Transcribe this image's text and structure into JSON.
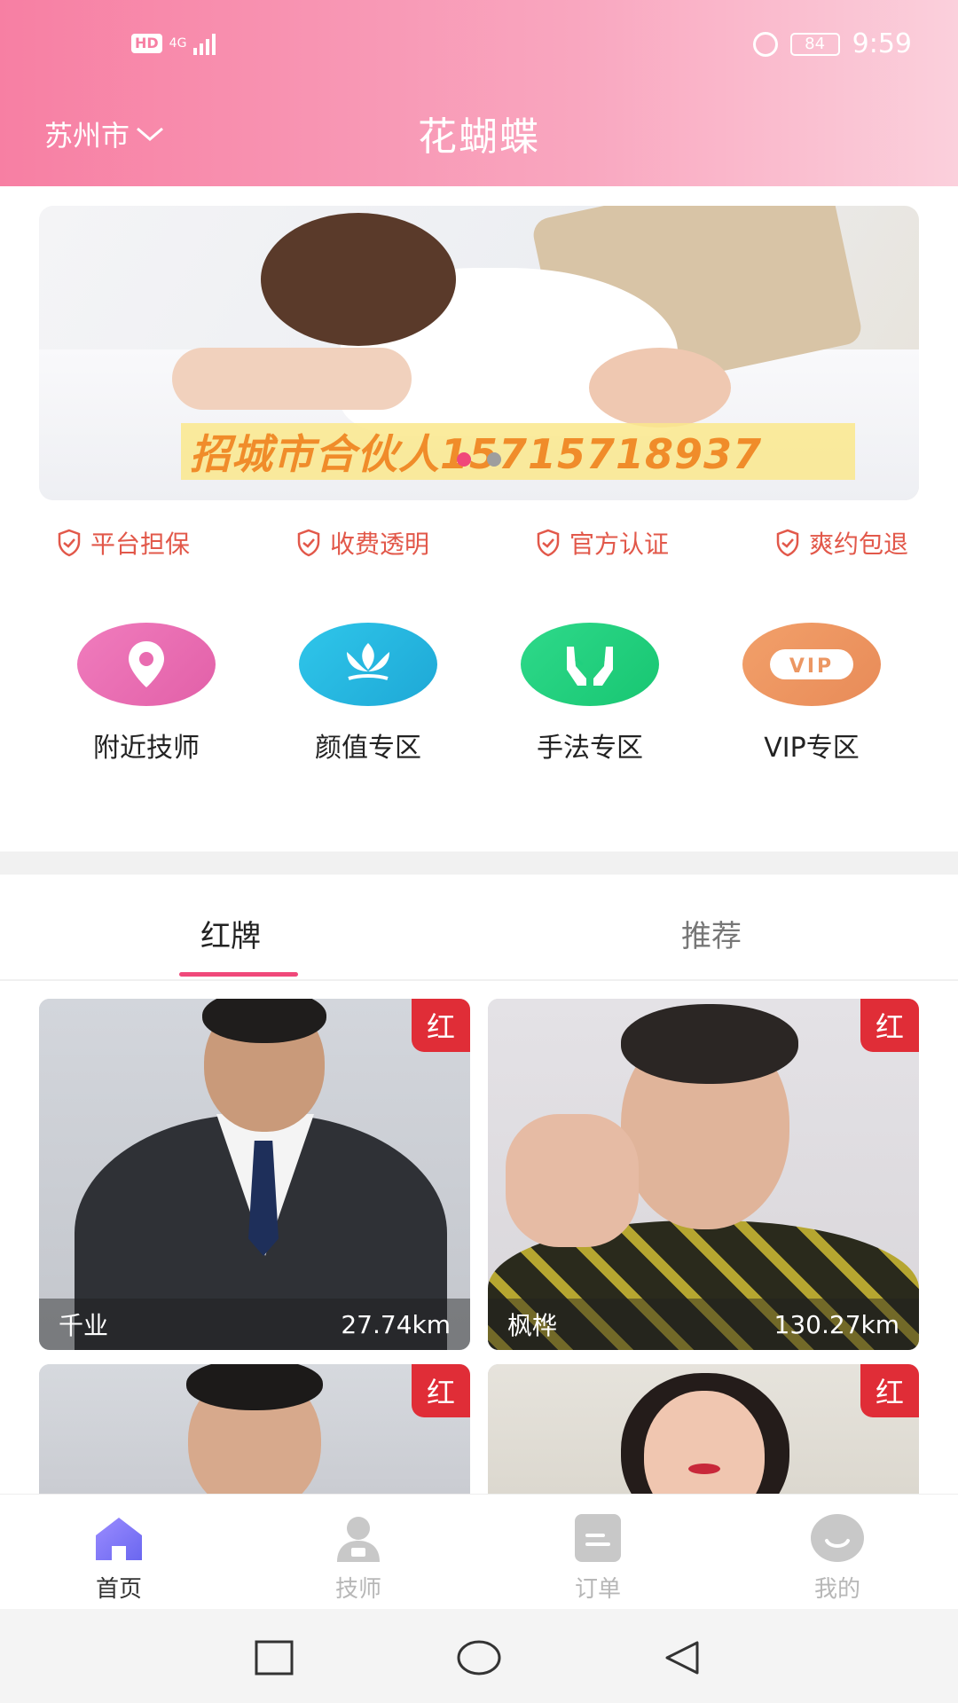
{
  "status_bar": {
    "network_badge": "HD",
    "network_type": "4G",
    "battery": "84",
    "time": "9:59"
  },
  "header": {
    "city": "苏州市",
    "title": "花蝴蝶"
  },
  "banner": {
    "text": "招城市合伙人15715718937",
    "slide_count": 2,
    "active_slide": 1
  },
  "guarantees": [
    "平台担保",
    "收费透明",
    "官方认证",
    "爽约包退"
  ],
  "categories": [
    {
      "label": "附近技师",
      "icon": "location-pin-icon",
      "color": "#e96bb0"
    },
    {
      "label": "颜值专区",
      "icon": "lotus-icon",
      "color": "#24b6e0"
    },
    {
      "label": "手法专区",
      "icon": "hands-icon",
      "color": "#21cf7e"
    },
    {
      "label": "VIP专区",
      "icon": "vip-icon",
      "color": "#ec9763",
      "icon_text": "VIP"
    }
  ],
  "tabs": [
    {
      "label": "红牌",
      "active": true
    },
    {
      "label": "推荐",
      "active": false
    }
  ],
  "cards": [
    {
      "name": "千业",
      "distance": "27.74km",
      "badge": "红"
    },
    {
      "name": "枫桦",
      "distance": "130.27km",
      "badge": "红"
    },
    {
      "name": "",
      "distance": "",
      "badge": "红"
    },
    {
      "name": "",
      "distance": "",
      "badge": "红"
    }
  ],
  "bottom_nav": [
    {
      "label": "首页",
      "icon": "home-icon",
      "active": true
    },
    {
      "label": "技师",
      "icon": "technician-icon",
      "active": false
    },
    {
      "label": "订单",
      "icon": "order-icon",
      "active": false
    },
    {
      "label": "我的",
      "icon": "profile-icon",
      "active": false
    }
  ],
  "colors": {
    "accent": "#f0487a",
    "header_start": "#f77fa3",
    "header_end": "#fbd0dc",
    "guarantee": "#e2584a",
    "badge": "#e02d37"
  }
}
